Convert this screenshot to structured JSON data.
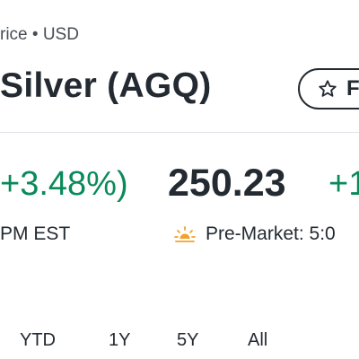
{
  "header": {
    "subheader": "rice • USD",
    "title": "Silver (AGQ)",
    "follow_label": "Follow"
  },
  "quote": {
    "close_change": "+3.48%)",
    "close_time": "PM EST",
    "premarket_price": "250.23",
    "premarket_change": "+1",
    "premarket_label": "Pre-Market: 5:0"
  },
  "range_tabs": [
    "YTD",
    "1Y",
    "5Y",
    "All"
  ],
  "icons": {
    "follow": "star-icon",
    "premarket": "sunrise-icon"
  },
  "colors": {
    "positive": "#0a8a5a",
    "premarket_icon": "#f0a22e",
    "text": "#232a31"
  }
}
